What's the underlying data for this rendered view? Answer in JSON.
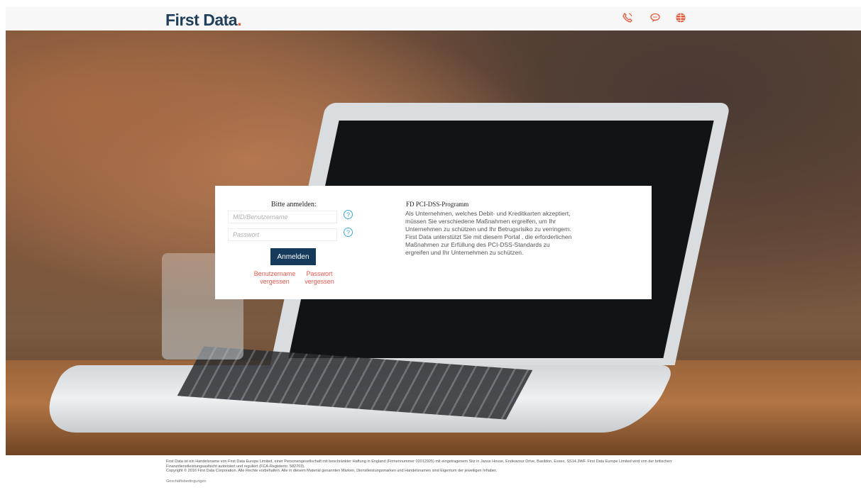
{
  "header": {
    "brand": "First Data",
    "brand_dot": ".",
    "icons": [
      "phone-icon",
      "chat-icon",
      "globe-icon"
    ],
    "accent": "#e05a3a"
  },
  "login": {
    "title": "Bitte anmelden:",
    "username_placeholder": "MID/Benutzername",
    "password_placeholder": "Passwort",
    "submit_label": "Anmelden",
    "forgot_username": "Benutzername vergessen",
    "forgot_password": "Passwort vergessen",
    "help_label": "?"
  },
  "info": {
    "title": "FD PCI-DSS-Programm",
    "text": "Als Unternehmen, welches Debit- und Kreditkarten akzeptiert, müssen Sie verschiedene Maßnahmen ergreifen, um Ihr Unternehmen zu schützen und Ihr Betrugsrisiko zu verringern. First Data unterstützt Sie mit diesem Portal , die erforderlichen Maßnahmen zur Erfüllung des PCI-DSS-Standards zu ergreifen und Ihr Unternehmen zu schützen."
  },
  "footer": {
    "line1": "First Data ist ein Handelsname von First Data Europe Limited, einer Personengesellschaft mit beschränkter Haftung in England (Firmennummer 02012925) mit eingetragenem Sitz in Janus House, Endeavour Drive, Basildon, Essex, SS14 3WF. First Data Europe Limited wird von der britischen Finanzdienstleistungsaufsicht autorisiert und reguliert (FCA-Registernr. 582703).",
    "line2": "Copyright © 2016 First Data Corporation. Alle Rechte vorbehalten. Alle in diesem Material genannten Marken, Dienstleistungsmarken und Handelsnamen sind Eigentum der jeweiligen Inhaber.",
    "terms": "Geschäftsbedingungen"
  }
}
